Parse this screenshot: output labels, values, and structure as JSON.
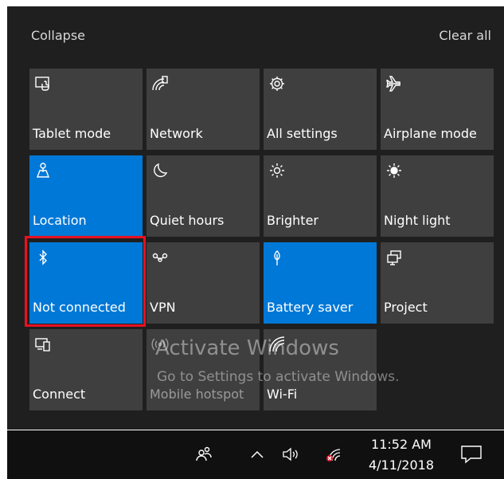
{
  "header": {
    "collapse_label": "Collapse",
    "clear_all_label": "Clear all"
  },
  "tiles": [
    {
      "label": "Tablet mode",
      "icon": "tablet-mode-icon",
      "active": false
    },
    {
      "label": "Network",
      "icon": "network-icon",
      "active": false
    },
    {
      "label": "All settings",
      "icon": "gear-icon",
      "active": false
    },
    {
      "label": "Airplane mode",
      "icon": "airplane-icon",
      "active": false
    },
    {
      "label": "Location",
      "icon": "location-icon",
      "active": true
    },
    {
      "label": "Quiet hours",
      "icon": "moon-icon",
      "active": false
    },
    {
      "label": "Brighter",
      "icon": "brightness-icon",
      "active": false
    },
    {
      "label": "Night light",
      "icon": "night-light-icon",
      "active": false
    },
    {
      "label": "Not connected",
      "icon": "bluetooth-icon",
      "active": true
    },
    {
      "label": "VPN",
      "icon": "vpn-icon",
      "active": false
    },
    {
      "label": "Battery saver",
      "icon": "battery-saver-icon",
      "active": true
    },
    {
      "label": "Project",
      "icon": "project-icon",
      "active": false
    },
    {
      "label": "Connect",
      "icon": "connect-icon",
      "active": false
    },
    {
      "label": "Mobile hotspot",
      "icon": "mobile-hotspot-icon",
      "active": false
    },
    {
      "label": "Wi-Fi",
      "icon": "wifi-icon",
      "active": false
    }
  ],
  "watermark": {
    "title": "Activate Windows",
    "subtitle": "Go to Settings to activate Windows."
  },
  "taskbar": {
    "time": "11:52 AM",
    "date": "4/11/2018",
    "icons": [
      "people-icon",
      "chevron-up-icon",
      "volume-icon",
      "network-disconnected-icon",
      "action-center-icon"
    ]
  },
  "colors": {
    "accent": "#0078d7",
    "tile": "#3f3f3f",
    "panel": "#1f1f1f",
    "highlight": "#e81123"
  }
}
